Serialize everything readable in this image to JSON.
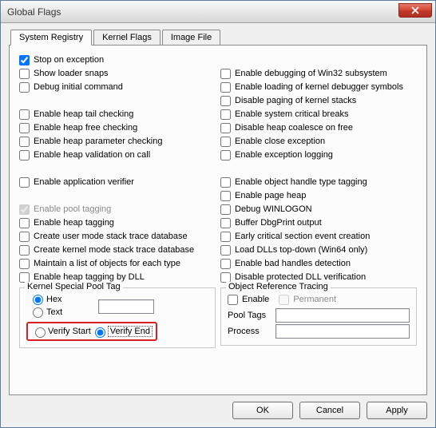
{
  "window": {
    "title": "Global Flags"
  },
  "tabs": [
    {
      "label": "System Registry",
      "active": true
    },
    {
      "label": "Kernel Flags",
      "active": false
    },
    {
      "label": "Image File",
      "active": false
    }
  ],
  "left_col": {
    "stop_on_exception": "Stop on exception",
    "show_loader_snaps": "Show loader snaps",
    "debug_initial_command": "Debug initial command",
    "enable_heap_tail_checking": "Enable heap tail checking",
    "enable_heap_free_checking": "Enable heap free checking",
    "enable_heap_parameter_checking": "Enable heap parameter checking",
    "enable_heap_validation_on_call": "Enable heap validation on call",
    "enable_application_verifier": "Enable application verifier",
    "enable_pool_tagging": "Enable pool tagging",
    "enable_heap_tagging": "Enable heap tagging",
    "create_user_mode_stack_trace_db": "Create user mode stack trace database",
    "create_kernel_mode_stack_trace_db": "Create kernel mode stack trace database",
    "maintain_list_objects": "Maintain a list of objects for each type",
    "enable_heap_tagging_by_dll": "Enable heap tagging by DLL"
  },
  "right_col": {
    "enable_debugging_win32": "Enable debugging of Win32 subsystem",
    "enable_loading_kernel_dbg_symbols": "Enable loading of kernel debugger symbols",
    "disable_paging_kernel_stacks": "Disable paging of kernel stacks",
    "enable_system_critical_breaks": "Enable system critical breaks",
    "disable_heap_coalesce_on_free": "Disable heap coalesce on free",
    "enable_close_exception": "Enable close exception",
    "enable_exception_logging": "Enable exception logging",
    "enable_object_handle_type_tagging": "Enable object handle type tagging",
    "enable_page_heap": "Enable page heap",
    "debug_winlogon": "Debug WINLOGON",
    "buffer_dbgprint_output": "Buffer DbgPrint output",
    "early_critical_section_event_creation": "Early critical section event creation",
    "load_dlls_top_down": "Load DLLs top-down (Win64 only)",
    "enable_bad_handles_detection": "Enable bad handles detection",
    "disable_protected_dll_verification": "Disable protected DLL verification"
  },
  "kspt": {
    "legend": "Kernel Special Pool Tag",
    "hex": "Hex",
    "text": "Text",
    "value": "",
    "verify_start": "Verify Start",
    "verify_end": "Verify End"
  },
  "ort": {
    "legend": "Object Reference Tracing",
    "enable": "Enable",
    "permanent": "Permanent",
    "pool_tags_label": "Pool Tags",
    "pool_tags_value": "",
    "process_label": "Process",
    "process_value": ""
  },
  "buttons": {
    "ok": "OK",
    "cancel": "Cancel",
    "apply": "Apply"
  },
  "checked": {
    "stop_on_exception": true,
    "enable_pool_tagging": true
  }
}
